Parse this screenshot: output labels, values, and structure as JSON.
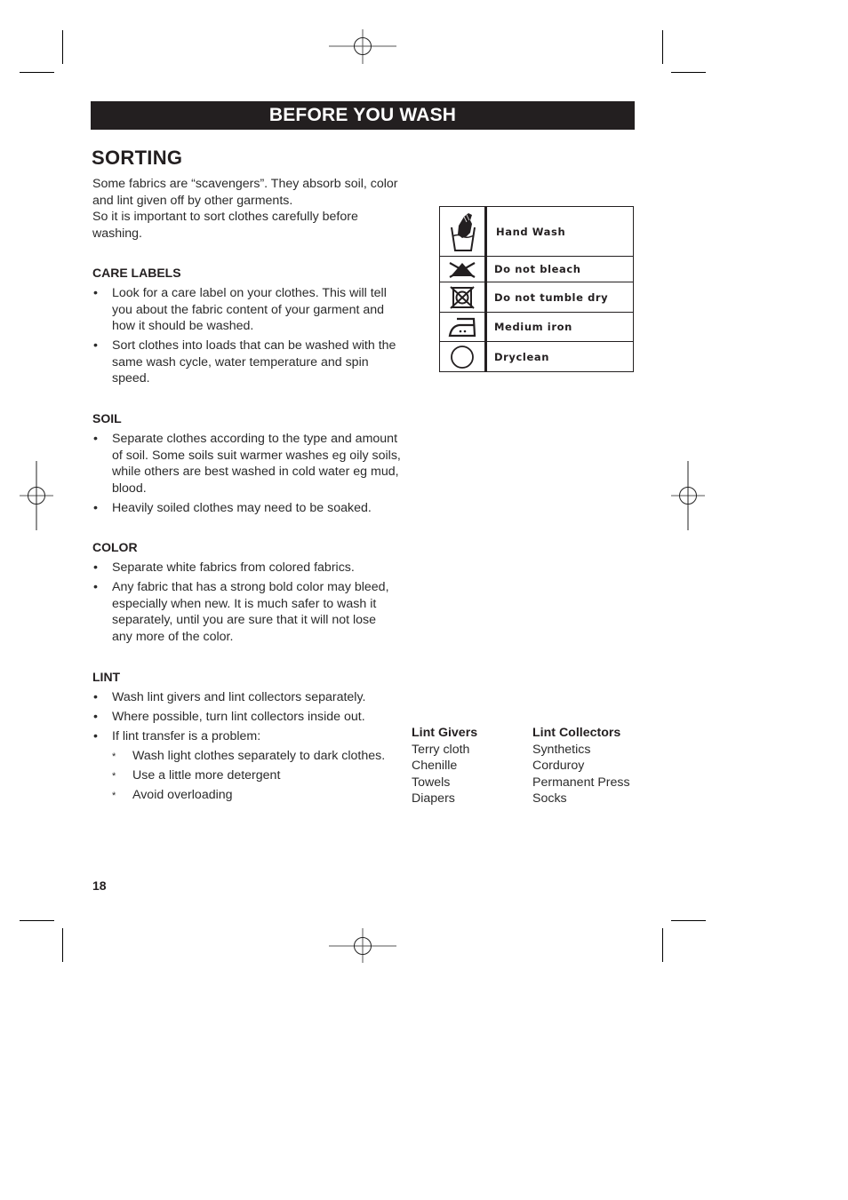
{
  "header": {
    "banner": "BEFORE YOU WASH"
  },
  "page": {
    "title": "SORTING",
    "number": "18",
    "intro": [
      "Some fabrics are “scavengers”. They absorb soil, color and lint given off by other garments.",
      "So it is important to sort clothes carefully before washing."
    ]
  },
  "sections": {
    "care_labels": {
      "heading": "CARE LABELS",
      "bullets": [
        "Look for a care label on your clothes. This will tell you about the fabric content of your garment and how it should be washed.",
        "Sort clothes into loads that can be washed with the same wash cycle, water temperature and spin speed."
      ]
    },
    "soil": {
      "heading": "SOIL",
      "bullets": [
        "Separate clothes according to the type and amount of soil. Some soils suit warmer washes eg oily soils, while others are best washed in cold water eg mud, blood.",
        "Heavily soiled clothes may need to be soaked."
      ]
    },
    "color": {
      "heading": "COLOR",
      "bullets": [
        "Separate white fabrics from colored fabrics.",
        "Any fabric that has a strong bold color may bleed, especially when new. It is much safer to wash it separately, until you are sure that it will not lose any more of the color."
      ]
    },
    "lint": {
      "heading": "LINT",
      "bullets": [
        "Wash lint givers and lint collectors separately.",
        "Where possible, turn lint collectors inside out.",
        "If lint transfer is a problem:"
      ],
      "sub_bullets": [
        "Wash light clothes separately to dark clothes.",
        "Use a little more detergent",
        "Avoid overloading"
      ]
    }
  },
  "bullet_glyph": "•",
  "sub_bullet_glyph": "*",
  "care_symbols": [
    {
      "icon": "hand-wash-icon",
      "label": "Hand Wash"
    },
    {
      "icon": "do-not-bleach-icon",
      "label": "Do not bleach"
    },
    {
      "icon": "do-not-tumble-dry-icon",
      "label": "Do not tumble dry"
    },
    {
      "icon": "medium-iron-icon",
      "label": "Medium iron"
    },
    {
      "icon": "dryclean-icon",
      "label": "Dryclean"
    }
  ],
  "lint_table": {
    "givers": {
      "heading": "Lint Givers",
      "items": [
        "Terry cloth",
        "Chenille",
        "Towels",
        "Diapers"
      ]
    },
    "collectors": {
      "heading": "Lint Collectors",
      "items": [
        "Synthetics",
        "Corduroy",
        "Permanent Press",
        "Socks"
      ]
    }
  },
  "colors": {
    "ink": "#231f20",
    "banner_text": "#ffffff",
    "page_background": "#ffffff"
  }
}
